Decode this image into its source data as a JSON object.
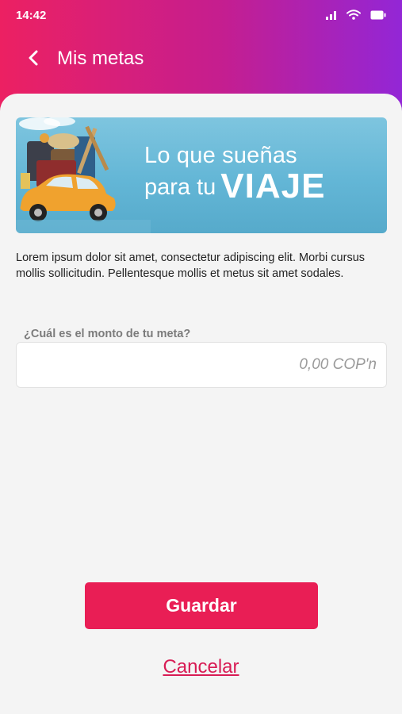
{
  "status_bar": {
    "time": "14:42",
    "icons": [
      "signal-icon",
      "wifi-icon",
      "battery-icon"
    ]
  },
  "header": {
    "title": "Mis metas",
    "back_icon": "chevron-left-icon",
    "gradient_colors": [
      "#ec2062",
      "#9326d6"
    ]
  },
  "banner": {
    "line1": "Lo que sueñas",
    "line2_prefix": "para tu",
    "line2_strong": "VIAJE",
    "image": "travel-car-luggage-illustration"
  },
  "description": "Lorem ipsum dolor sit amet, consectetur adipiscing elit. Morbi cursus mollis sollicitudin. Pellentesque mollis et metus sit amet sodales.",
  "form": {
    "amount_label": "¿Cuál es el monto de tu meta?",
    "amount_placeholder": "0,00 COP'n",
    "amount_value": ""
  },
  "actions": {
    "save_label": "Guardar",
    "cancel_label": "Cancelar",
    "accent_color": "#e91e55"
  }
}
